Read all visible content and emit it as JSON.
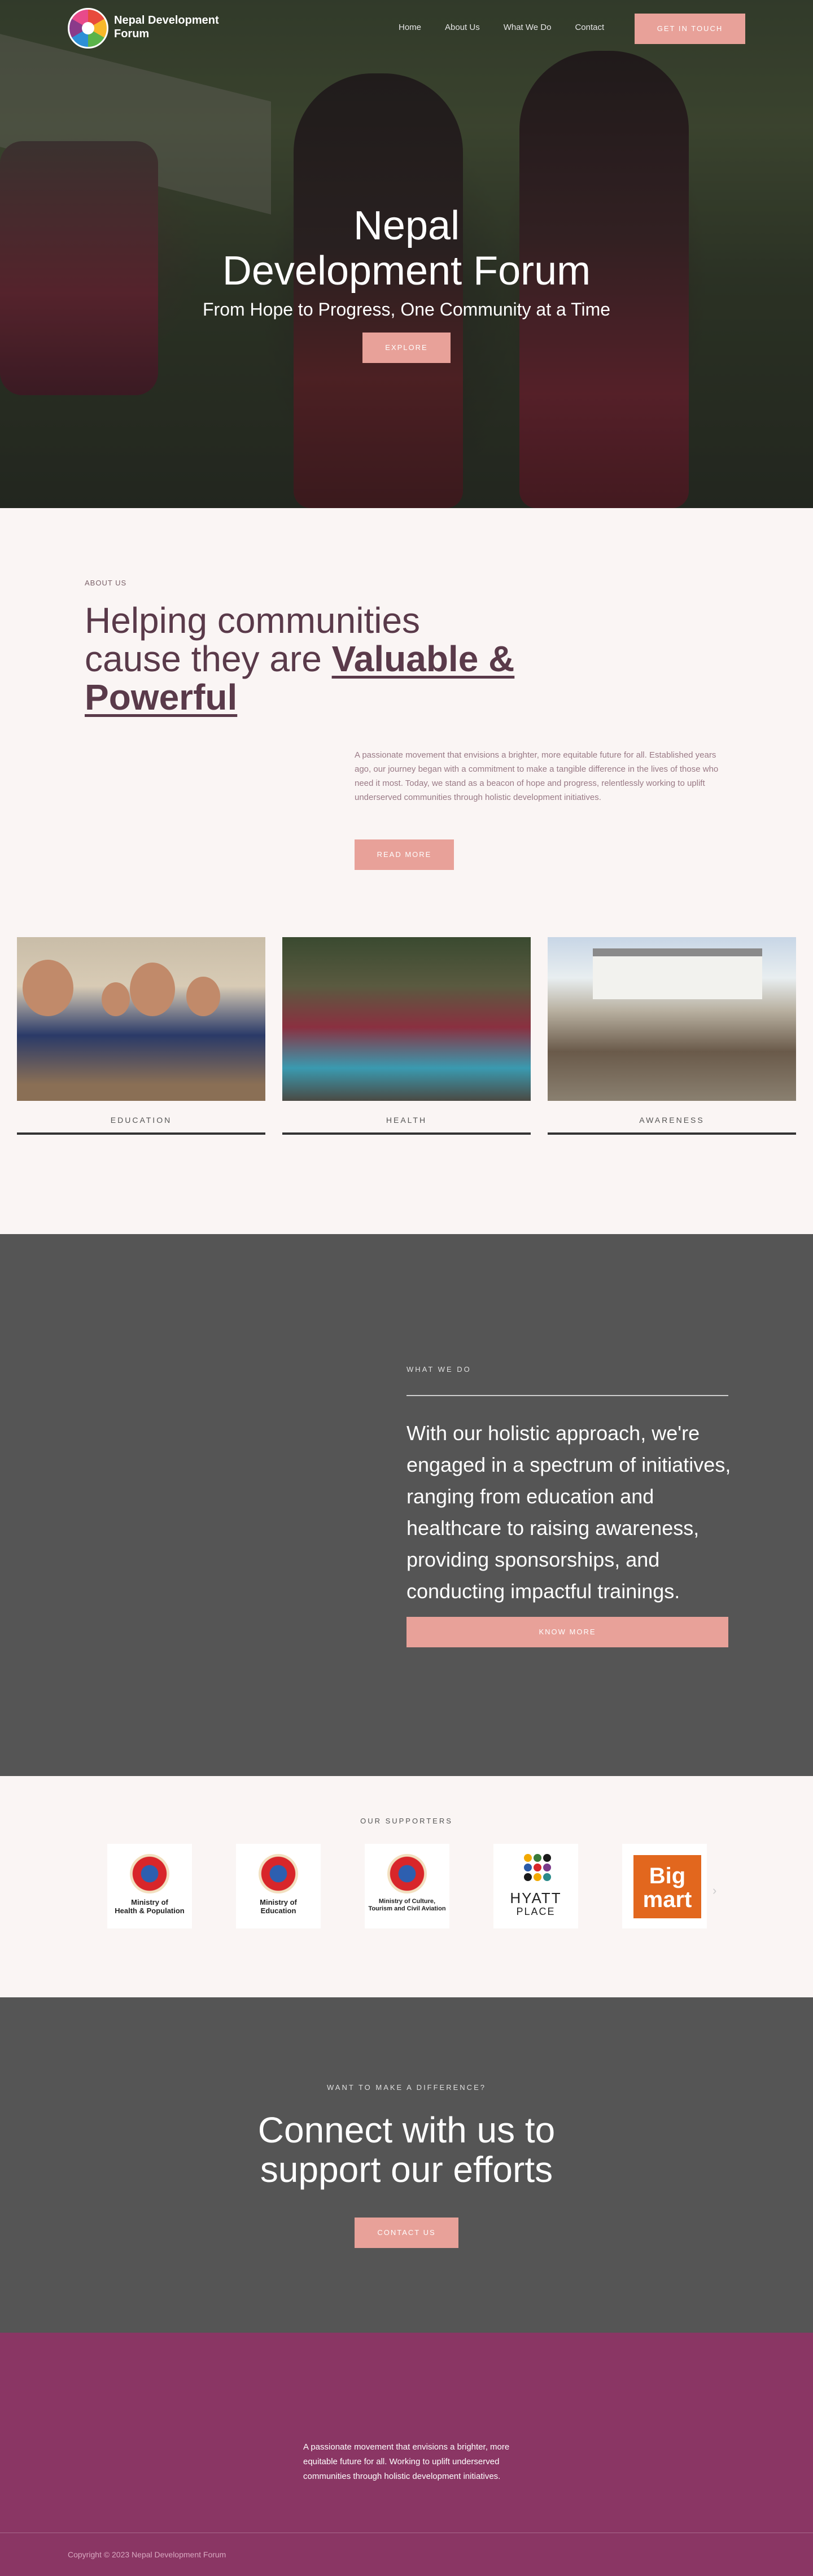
{
  "nav": {
    "brand": "Nepal Development Forum",
    "links": [
      "Home",
      "About Us",
      "What We Do",
      "Contact"
    ],
    "cta": "GET IN TOUCH"
  },
  "hero": {
    "title_line1": "Nepal",
    "title_line2": "Development Forum",
    "subtitle": "From Hope to Progress, One Community at a Time",
    "button": "EXPLORE"
  },
  "about": {
    "eyebrow": "ABOUT US",
    "heading_plain": "Helping communities cause they are",
    "heading_highlight": "Valuable & Powerful",
    "text": "A passionate movement that envisions a brighter, more equitable future for all. Established years ago, our journey began with a commitment to make a tangible difference in the lives of those who need it most. Today, we stand as a beacon of hope and progress, relentlessly working to uplift underserved communities through holistic development initiatives.",
    "button": "READ MORE"
  },
  "cards": [
    {
      "label": "EDUCATION"
    },
    {
      "label": "HEALTH"
    },
    {
      "label": "AWARENESS"
    }
  ],
  "what_we_do": {
    "eyebrow": "WHAT WE DO",
    "text": "With our holistic approach, we're engaged in a spectrum of initiatives, ranging from education and healthcare to raising awareness, providing sponsorships, and conducting impactful trainings.",
    "button": "KNOW MORE"
  },
  "supporters": {
    "eyebrow": "OUR SUPPORTERS",
    "logos": [
      {
        "line1": "Ministry of",
        "line2": "Health & Population"
      },
      {
        "line1": "Ministry of",
        "line2": "Education"
      },
      {
        "line1": "Ministry of Culture,",
        "line2": "Tourism and Civil Aviation"
      },
      {
        "word1": "HYATT",
        "word2": "PLACE"
      },
      {
        "word1": "Big",
        "word2": "mart"
      }
    ]
  },
  "connect": {
    "eyebrow": "WANT TO MAKE A DIFFERENCE?",
    "heading_line1": "Connect with us to",
    "heading_line2": "support our efforts",
    "button": "CONTACT US"
  },
  "footer": {
    "text": "A passionate movement that envisions a brighter, more equitable future for all. Working to uplift underserved communities through holistic development initiatives.",
    "copyright": "Copyright © 2023 Nepal Development Forum"
  },
  "colors": {
    "accent": "#e8a199",
    "heading": "#5a3a4a",
    "dark_section": "#555555",
    "footer": "#8a3664"
  }
}
